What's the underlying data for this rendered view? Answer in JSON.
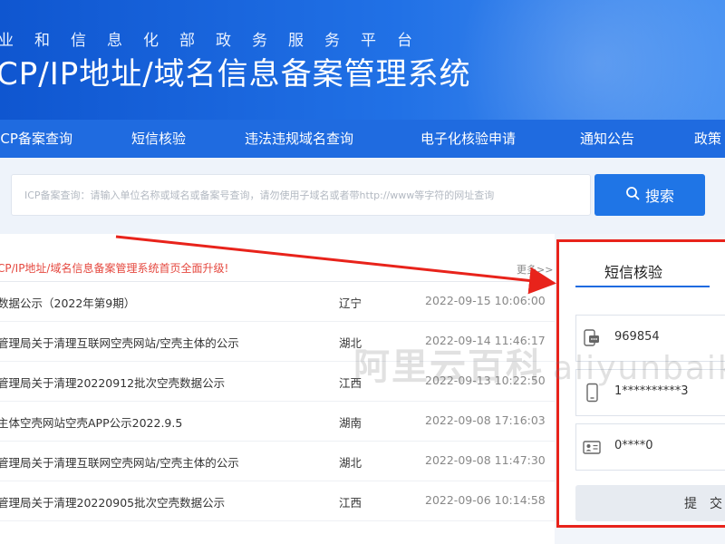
{
  "header": {
    "subtitle": "业和信息化部政务服务平台",
    "title": "CP/IP地址/域名信息备案管理系统"
  },
  "nav": {
    "items": [
      "ICP备案查询",
      "短信核验",
      "违法违规域名查询",
      "电子化核验申请",
      "通知公告",
      "政策"
    ]
  },
  "search": {
    "placeholder": "ICP备案查询：请输入单位名称或域名或备案号查询，请勿使用子域名或者带http://www等字符的网址查询",
    "button_label": "搜索"
  },
  "news": {
    "headline": "CP/IP地址/域名信息备案管理系统首页全面升级!",
    "more_label": "更多>>",
    "rows": [
      {
        "title": "数据公示（2022年第9期）",
        "region": "辽宁",
        "date": "2022-09-15 10:06:00"
      },
      {
        "title": "管理局关于清理互联网空壳网站/空壳主体的公示",
        "region": "湖北",
        "date": "2022-09-14 11:46:17"
      },
      {
        "title": "管理局关于清理20220912批次空壳数据公示",
        "region": "江西",
        "date": "2022-09-13 10:22:50"
      },
      {
        "title": "主体空壳网站空壳APP公示2022.9.5",
        "region": "湖南",
        "date": "2022-09-08 17:16:03"
      },
      {
        "title": "管理局关于清理互联网空壳网站/空壳主体的公示",
        "region": "湖北",
        "date": "2022-09-08 11:47:30"
      },
      {
        "title": "管理局关于清理20220905批次空壳数据公示",
        "region": "江西",
        "date": "2022-09-06 10:14:58"
      }
    ]
  },
  "sms": {
    "tab_label": "短信核验",
    "fields": [
      {
        "icon": "sms-code-icon",
        "value": "969854"
      },
      {
        "icon": "phone-icon",
        "value": "1**********3"
      },
      {
        "icon": "id-card-icon",
        "value": "0****0"
      }
    ],
    "submit_label": "提交"
  },
  "watermark": {
    "text_cn": "阿里云百科",
    "text_en": "aliyunbaike"
  },
  "colors": {
    "header_blue": "#1f6be0",
    "highlight_red": "#e8231b",
    "headline_red": "#e5483f"
  }
}
